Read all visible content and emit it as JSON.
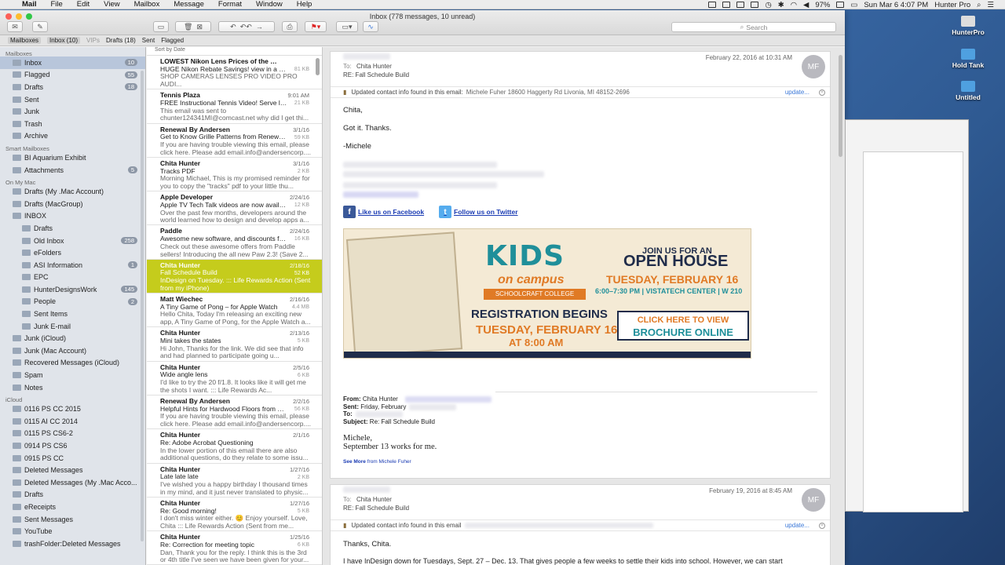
{
  "menubar": {
    "app": "Mail",
    "items": [
      "File",
      "Edit",
      "View",
      "Mailbox",
      "Message",
      "Format",
      "Window",
      "Help"
    ],
    "battery": "97%",
    "clock": "Sun Mar 6  4:07 PM",
    "user": "Hunter Pro"
  },
  "window": {
    "title": "Inbox (778 messages, 10 unread)",
    "search_placeholder": "Search"
  },
  "favorites": {
    "mailboxes": "Mailboxes",
    "inbox": "Inbox (10)",
    "vips": "VIPs",
    "drafts": "Drafts (18)",
    "sent": "Sent",
    "flagged": "Flagged"
  },
  "sidebar": {
    "mailboxes_header": "Mailboxes",
    "mailboxes": [
      {
        "label": "Inbox",
        "badge": "10"
      },
      {
        "label": "Flagged",
        "badge": "55"
      },
      {
        "label": "Drafts",
        "badge": "18"
      },
      {
        "label": "Sent",
        "badge": ""
      },
      {
        "label": "Junk",
        "badge": ""
      },
      {
        "label": "Trash",
        "badge": ""
      },
      {
        "label": "Archive",
        "badge": ""
      }
    ],
    "smart_header": "Smart Mailboxes",
    "smart": [
      {
        "label": "BI Aquarium Exhibit",
        "badge": ""
      },
      {
        "label": "Attachments",
        "badge": "5"
      }
    ],
    "mac_header": "On My Mac",
    "mac": [
      {
        "label": "Drafts (My .Mac Account)",
        "badge": ""
      },
      {
        "label": "Drafts (MacGroup)",
        "badge": ""
      },
      {
        "label": "INBOX",
        "badge": ""
      },
      {
        "label": "Drafts",
        "badge": ""
      },
      {
        "label": "Old Inbox",
        "badge": "258"
      },
      {
        "label": "eFolders",
        "badge": ""
      },
      {
        "label": "ASI Information",
        "badge": "1"
      },
      {
        "label": "EPC",
        "badge": ""
      },
      {
        "label": "HunterDesignsWork",
        "badge": "145"
      },
      {
        "label": "People",
        "badge": "2"
      },
      {
        "label": "Sent Items",
        "badge": ""
      },
      {
        "label": "Junk E-mail",
        "badge": ""
      },
      {
        "label": "Junk (iCloud)",
        "badge": ""
      },
      {
        "label": "Junk (Mac Account)",
        "badge": ""
      },
      {
        "label": "Recovered Messages (iCloud)",
        "badge": ""
      },
      {
        "label": "Spam",
        "badge": ""
      },
      {
        "label": "Notes",
        "badge": ""
      }
    ],
    "icloud_header": "iCloud",
    "icloud": [
      {
        "label": "0116 PS CC 2015",
        "badge": ""
      },
      {
        "label": "0115 AI CC 2014",
        "badge": ""
      },
      {
        "label": "0115 PS CS6-2",
        "badge": ""
      },
      {
        "label": "0914 PS CS6",
        "badge": ""
      },
      {
        "label": "0915 PS CC",
        "badge": ""
      },
      {
        "label": "Deleted Messages",
        "badge": ""
      },
      {
        "label": "Deleted Messages (My .Mac Acco...",
        "badge": ""
      },
      {
        "label": "Drafts",
        "badge": ""
      },
      {
        "label": "eReceipts",
        "badge": ""
      },
      {
        "label": "Sent Messages",
        "badge": ""
      },
      {
        "label": "YouTube",
        "badge": ""
      },
      {
        "label": "trashFolder:Deleted Messages",
        "badge": ""
      }
    ]
  },
  "message_list": {
    "sort_label": "Sort by Date",
    "messages": [
      {
        "from": "LOWEST Nikon Lens Prices of the Year!",
        "date": "",
        "size": "81 KB",
        "subject": "HUGE Nikon Rebate Savings! view in a browser",
        "preview": "SHOP CAMERAS LENSES PRO VIDEO PRO AUDI..."
      },
      {
        "from": "Tennis Plaza",
        "date": "9:01 AM",
        "size": "21 KB",
        "subject": "FREE Instructional Tennis Video! Serve lik...",
        "preview": "This email was sent to chunter124341MI@comcast.net why did I get thi..."
      },
      {
        "from": "Renewal By Andersen",
        "date": "3/1/16",
        "size": "59 KB",
        "subject": "Get to Know Grille Patterns from Renewal...",
        "preview": "If you are having trouble viewing this email, please click here. Please add email.info@andersencorp...."
      },
      {
        "from": "Chita Hunter",
        "date": "3/1/16",
        "size": "2 KB",
        "subject": "Tracks PDF",
        "preview": "Morning Michael, This is my promised reminder for you to copy the \"tracks\" pdf to your little thu..."
      },
      {
        "from": "Apple Developer",
        "date": "2/24/16",
        "size": "12 KB",
        "subject": "Apple TV Tech Talk videos are now availab...",
        "preview": "Over the past few months, developers around the world learned how to design and develop apps a..."
      },
      {
        "from": "Paddle",
        "date": "2/24/16",
        "size": "16 KB",
        "subject": "Awesome new software, and discounts for...",
        "preview": "Check out these awesome offers from Paddle sellers! Introducing the all new Paw 2.3! (Save 2..."
      },
      {
        "from": "Chita Hunter",
        "date": "2/18/16",
        "size": "52 KB",
        "subject": "Fall Schedule Build",
        "preview": "InDesign on Tuesday. ::: Life Rewards Action (Sent from my iPhone)"
      },
      {
        "from": "Matt Wiechec",
        "date": "2/16/16",
        "size": "4.4 MB",
        "subject": "A Tiny Game of Pong – for Apple Watch",
        "preview": "Hello Chita, Today I'm releasing an exciting new app, A Tiny Game of Pong, for the Apple Watch a..."
      },
      {
        "from": "Chita Hunter",
        "date": "2/13/16",
        "size": "5 KB",
        "subject": "Mini takes the states",
        "preview": "Hi John, Thanks for the link. We did see that info and had planned to participate going u..."
      },
      {
        "from": "Chita Hunter",
        "date": "2/5/16",
        "size": "6 KB",
        "subject": "Wide angle lens",
        "preview": "I'd like to try the 20 f/1.8. It looks like it will get me the shots I want. ::: Life Rewards Ac..."
      },
      {
        "from": "Renewal By Andersen",
        "date": "2/2/16",
        "size": "56 KB",
        "subject": "Helpful Hints for Hardwood Floors from R...",
        "preview": "If you are having trouble viewing this email, please click here. Please add email.info@andersencorp...."
      },
      {
        "from": "Chita Hunter",
        "date": "2/1/16",
        "size": "",
        "subject": "Re: Adobe Acrobat Questioning",
        "preview": "In the lower portion of this email there are also additional questions, do they relate to some issu..."
      },
      {
        "from": "Chita Hunter",
        "date": "1/27/16",
        "size": "2 KB",
        "subject": "Late late late",
        "preview": "I've wished you a happy birthday I thousand times in my mind, and it just never translated to physic..."
      },
      {
        "from": "Chita Hunter",
        "date": "1/27/16",
        "size": "5 KB",
        "subject": "Re: Good morning!",
        "preview": "I don't miss winter either. 😊 Enjoy yourself. Love, Chita ::: Life Rewards Action (Sent from me..."
      },
      {
        "from": "Chita Hunter",
        "date": "1/25/16",
        "size": "6 KB",
        "subject": "Re: Correction for meeting topic",
        "preview": "Dan, Thank you for the reply. I think this is the 3rd or 4th title I've seen we have been given for your..."
      }
    ]
  },
  "reader": {
    "msg1": {
      "to_label": "To:",
      "to": "Chita Hunter",
      "subject": "RE: Fall Schedule Build",
      "date": "February 22, 2016 at 10:31 AM",
      "avatar": "MF",
      "contact_text": "Updated contact info found in this email:",
      "contact_detail": "Michele Fuher  18600 Haggerty Rd  Livonia, MI 48152-2696",
      "update": "update...",
      "greeting": "Chita,",
      "line1": "Got it.  Thanks.",
      "signoff": "-Michele",
      "facebook": "Like us on Facebook",
      "twitter": "Follow us on Twitter",
      "from_label": "From:",
      "from": "Chita Hunter",
      "sent_label": "Sent:",
      "sent": "Friday, February",
      "to2_label": "To:",
      "subject_label": "Subject:",
      "subject2": "Re: Fall Schedule Build",
      "quote1": "Michele,",
      "quote2": "September 13 works for me.",
      "see_more": "See More",
      "see_more_from": "from Michele Fuher"
    },
    "banner": {
      "kids": "KIDS",
      "on_campus": "on campus",
      "college": "SCHOOLCRAFT COLLEGE",
      "reg": "REGISTRATION BEGINS",
      "reg_date": "TUESDAY, FEBRUARY 16",
      "reg_time": "AT 8:00 AM",
      "join": "JOIN US FOR AN",
      "open_house": "OPEN HOUSE",
      "oh_date": "TUESDAY, FEBRUARY 16",
      "oh_time": "6:00–7:30 PM | VISTATECH CENTER | W 210",
      "cta1": "CLICK HERE TO VIEW",
      "cta2": "BROCHURE ONLINE"
    },
    "msg2": {
      "to_label": "To:",
      "to": "Chita Hunter",
      "subject": "RE: Fall Schedule Build",
      "date": "February 19, 2016 at 8:45 AM",
      "avatar": "MF",
      "contact_text": "Updated contact info found in this email",
      "update": "update...",
      "greeting": "Thanks, Chita.",
      "line1": "I have InDesign down for Tuesdays, Sept. 27 – Dec. 13.  That gives people a few weeks to settle their kids into school.  However, we can start"
    }
  },
  "desktop": {
    "icons": [
      "HunterPro",
      "Hold Tank",
      "Untitled"
    ]
  },
  "colors": {
    "selected_row": "#c5cc1c",
    "accent": "#3b78d8",
    "sidebar": "#e0e4ea"
  }
}
